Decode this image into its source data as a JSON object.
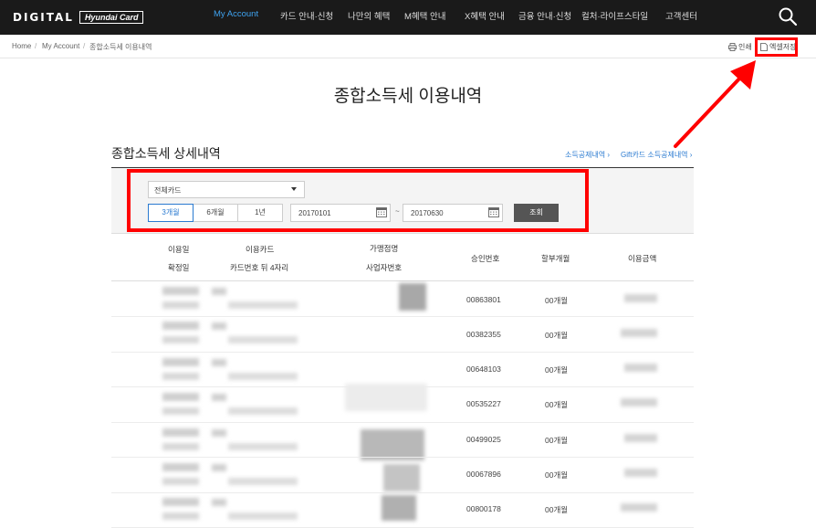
{
  "nav": {
    "logo_text": "DIGITAL",
    "logo_box": "Hyundai Card",
    "items": [
      "My Account",
      "카드 안내·신청",
      "나만의 혜택",
      "M혜택 안내",
      "X혜택 안내",
      "금융 안내·신청",
      "컬처·라이프스타일",
      "고객센터"
    ],
    "active_color": "#3fa3f0"
  },
  "breadcrumb": [
    "Home",
    "My Account",
    "종합소득세 이용내역"
  ],
  "utility": {
    "print": "인쇄",
    "excel": "엑셀저장"
  },
  "page_title": "종합소득세 이용내역",
  "section": {
    "title": "종합소득세 상세내역",
    "link_deduction": "소득공제내역 ›",
    "link_giftcard": "Gift카드 소득공제내역 ›"
  },
  "filter": {
    "card_select": "전체카드",
    "periods": [
      "3개월",
      "6개월",
      "1년"
    ],
    "active_period": "3개월",
    "date_from": "20170101",
    "date_to": "20170630",
    "tilde": "~",
    "search_label": "조회"
  },
  "table": {
    "headers": {
      "use_date": "이용일",
      "confirm_date": "확정일",
      "card": "이용카드",
      "card_last4": "카드번호 뒤 4자리",
      "merchant": "가맹점명",
      "biz_no": "사업자번호",
      "approval": "승인번호",
      "installment": "할부개월",
      "amount": "이용금액"
    },
    "rows": [
      {
        "approval": "00863801",
        "installment": "00개월"
      },
      {
        "approval": "00382355",
        "installment": "00개월"
      },
      {
        "approval": "00648103",
        "installment": "00개월"
      },
      {
        "approval": "00535227",
        "installment": "00개월"
      },
      {
        "approval": "00499025",
        "installment": "00개월"
      },
      {
        "approval": "00067896",
        "installment": "00개월"
      },
      {
        "approval": "00800178",
        "installment": "00개월"
      }
    ]
  },
  "annotation_color": "#ff0000"
}
